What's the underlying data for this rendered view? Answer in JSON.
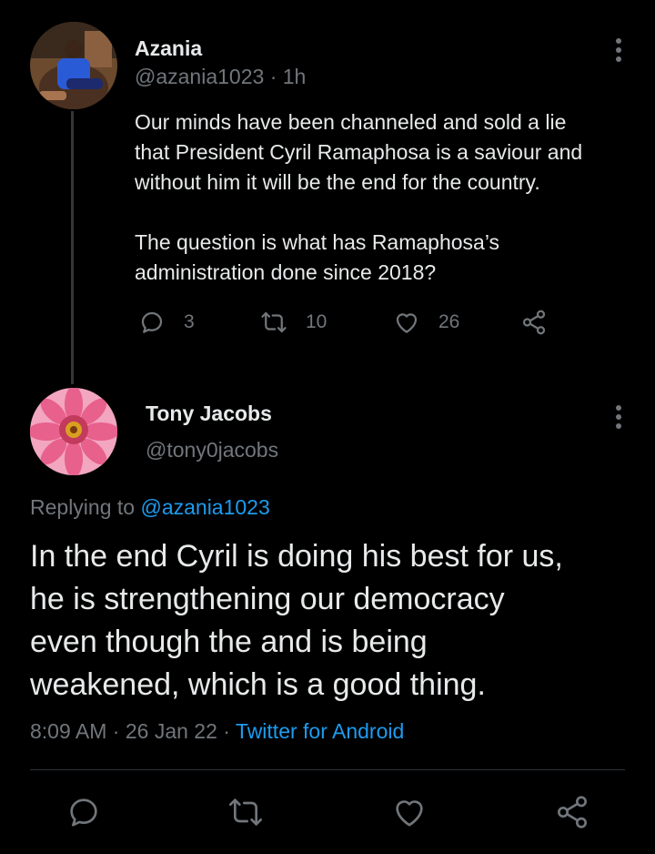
{
  "parent_tweet": {
    "name": "Azania",
    "handle": "@azania1023",
    "separator": "·",
    "time": "1h",
    "paragraphs": [
      [
        "Our minds have been channeled and sold a lie",
        "that President Cyril Ramaphosa is a saviour and",
        "without him it will be the end for the country."
      ],
      [
        "The question is what has Ramaphosa’s",
        "administration done since 2018?"
      ]
    ],
    "replies": "3",
    "retweets": "10",
    "likes": "26",
    "icons": {
      "more": "more-vertical-icon",
      "reply": "reply-icon",
      "retweet": "retweet-icon",
      "like": "heart-icon",
      "share": "share-icon"
    }
  },
  "main_tweet": {
    "name": "Tony Jacobs",
    "handle": "@tony0jacobs",
    "replying_prefix": "Replying to",
    "replying_to": "@azania1023",
    "text_lines": [
      "In the end Cyril is doing his best for us,",
      "he is strengthening our democracy",
      "even though the and is being",
      "weakened, which is a good thing."
    ],
    "time": "8:09 AM",
    "separator": "·",
    "date": "26 Jan 22",
    "source": "Twitter for Android"
  },
  "colors": {
    "background": "#000000",
    "text": "#e7e9ea",
    "secondary": "#71767b",
    "link": "#1d9bf0"
  }
}
